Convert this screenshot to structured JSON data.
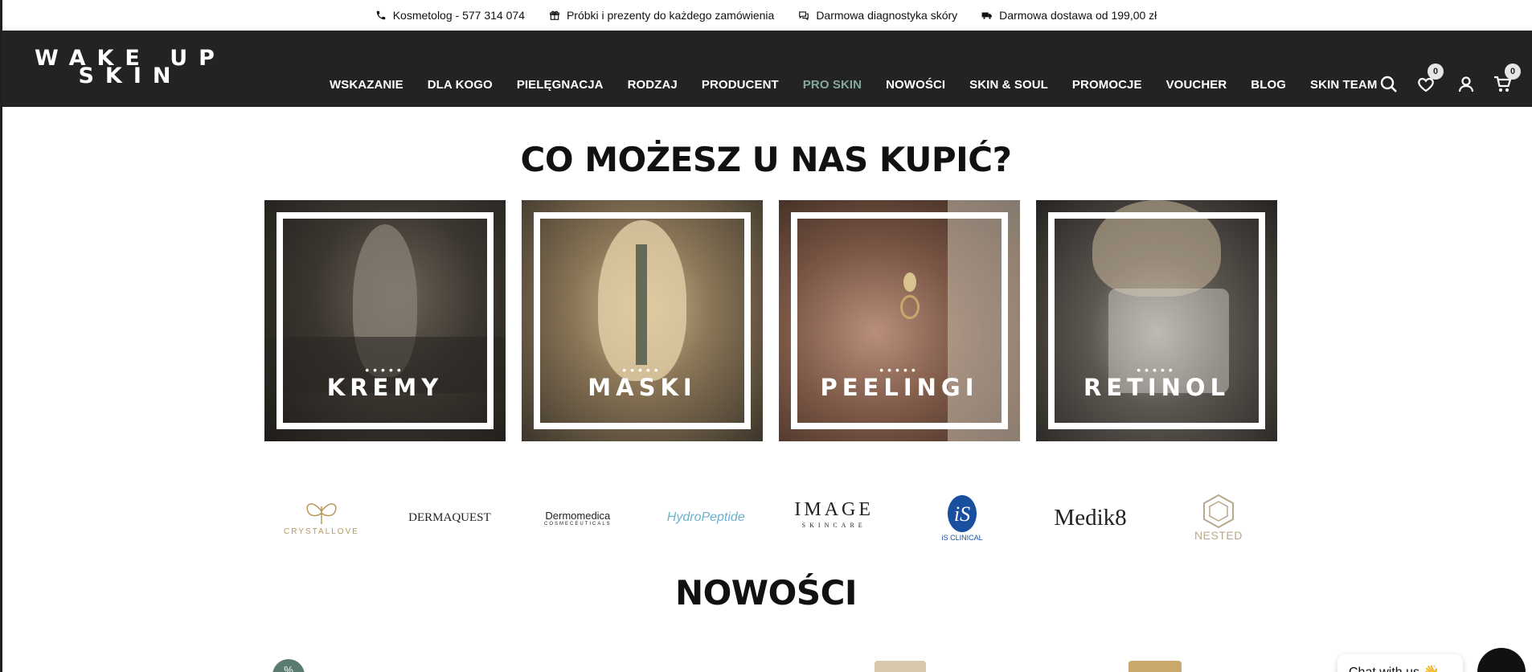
{
  "topbar": {
    "items": [
      {
        "icon": "phone-icon",
        "text": "Kosmetolog - 577 314 074"
      },
      {
        "icon": "gift-icon",
        "text": "Próbki i prezenty do każdego zamówienia"
      },
      {
        "icon": "chat-icon",
        "text": "Darmowa diagnostyka skóry"
      },
      {
        "icon": "truck-icon",
        "text": "Darmowa dostawa od 199,00 zł"
      }
    ]
  },
  "header": {
    "logo_line1": "WAKE UP",
    "logo_line2": "SKIN",
    "nav": [
      "WSKAZANIE",
      "DLA KOGO",
      "PIELĘGNACJA",
      "RODZAJ",
      "PRODUCENT",
      "PRO SKIN",
      "NOWOŚCI",
      "SKIN & SOUL",
      "PROMOCJE",
      "VOUCHER",
      "BLOG",
      "SKIN TEAM"
    ],
    "active_nav": "PRO SKIN",
    "accent_color": "#84a89b",
    "wishlist_count": "0",
    "cart_count": "0"
  },
  "categories": {
    "title": "CO MOŻESZ U NAS KUPIĆ?",
    "dots": "•••••",
    "items": [
      {
        "label": "KREMY"
      },
      {
        "label": "MASKI"
      },
      {
        "label": "PEELINGI"
      },
      {
        "label": "RETINOL"
      }
    ]
  },
  "brands": {
    "items": [
      {
        "name": "CRYSTALLOVE"
      },
      {
        "name": "DERMAQUEST"
      },
      {
        "name": "Dermomedica",
        "tagline": "COSMECEUTICALS"
      },
      {
        "name": "HydroPeptide"
      },
      {
        "name": "IMAGE",
        "tagline": "SKINCARE"
      },
      {
        "name": "iS CLINICAL"
      },
      {
        "name": "Medik8"
      },
      {
        "name": "NESTED"
      }
    ]
  },
  "news": {
    "title": "NOWOŚCI",
    "discount_badge": "%"
  },
  "chat": {
    "label": "Chat with us 👋"
  }
}
